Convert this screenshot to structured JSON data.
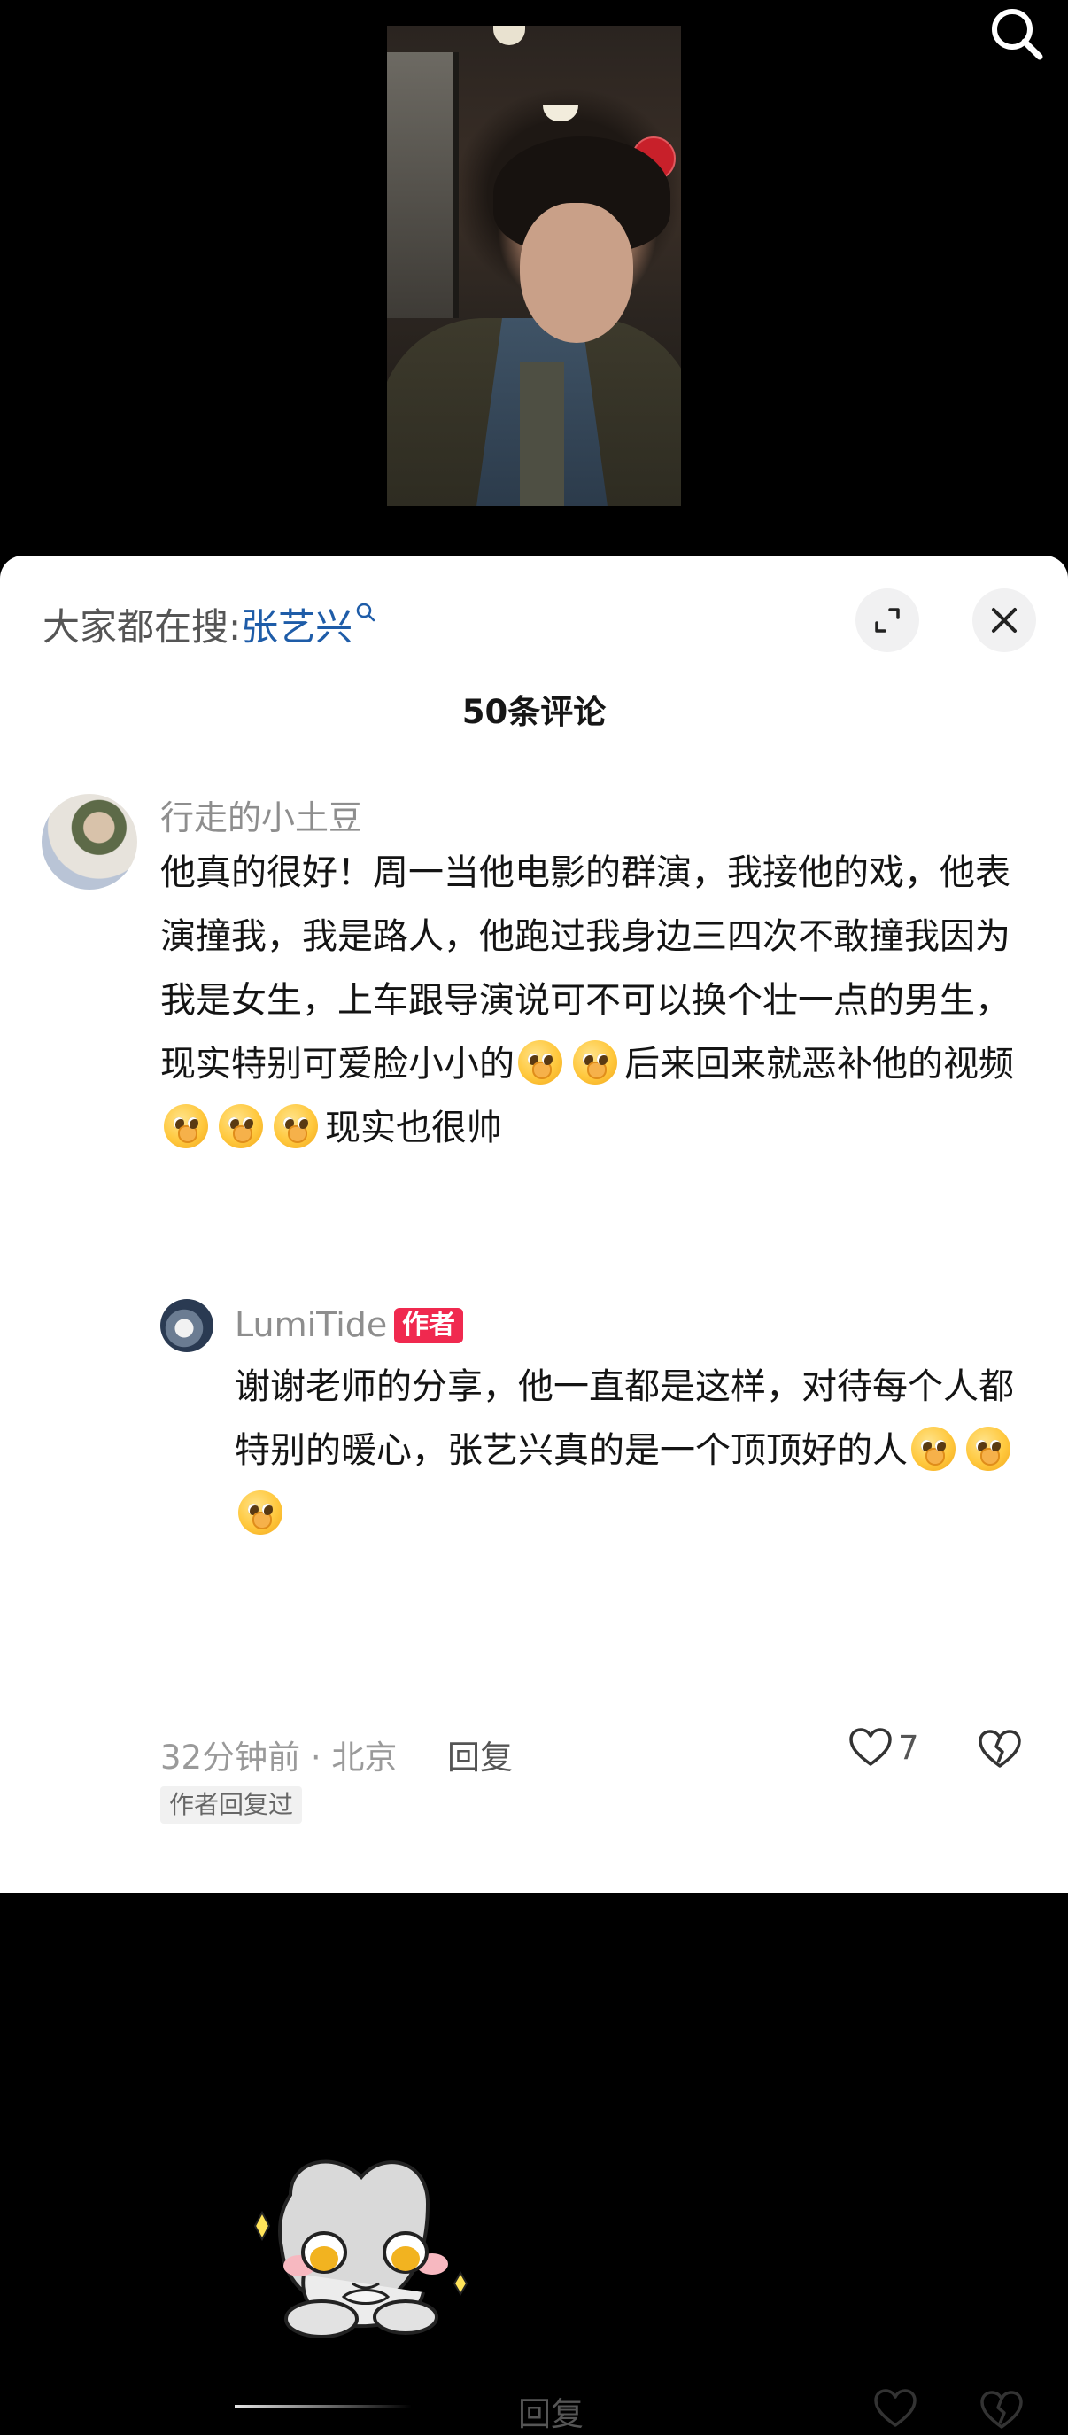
{
  "hot_search": {
    "prefix": "大家都在搜:",
    "keyword": "张艺兴"
  },
  "comments_title": "50条评论",
  "comment": {
    "username": "行走的小土豆",
    "text_before_emojis_1": "他真的很好！周一当他电影的群演，我接他的戏，他表演撞我，我是路人，他跑过我身边三四次不敢撞我因为我是女生，上车跟导演说可不可以换个壮一点的男生，现实特别可爱脸小小的",
    "text_after_emojis_1": "后来回来就恶补他的视频",
    "text_after_emojis_2": "现实也很帅",
    "time_location": "32分钟前 · 北京",
    "reply_label": "回复",
    "like_count": "7",
    "author_replied_badge": "作者回复过"
  },
  "reply": {
    "username": "LumiTide",
    "author_tag": "作者",
    "text": "谢谢老师的分享，他一直都是这样，对待每个人都特别的暖心，张艺兴真的是一个顶顶好的人",
    "reply_label": "回复"
  },
  "icons": {
    "search": "search-icon",
    "expand": "expand-icon",
    "close": "close-icon",
    "like": "heart-icon",
    "dislike": "broken-heart-icon",
    "emoji": "pleading-face-emoji"
  },
  "colors": {
    "link": "#1e5ca8",
    "author_tag": "#f0294f"
  }
}
